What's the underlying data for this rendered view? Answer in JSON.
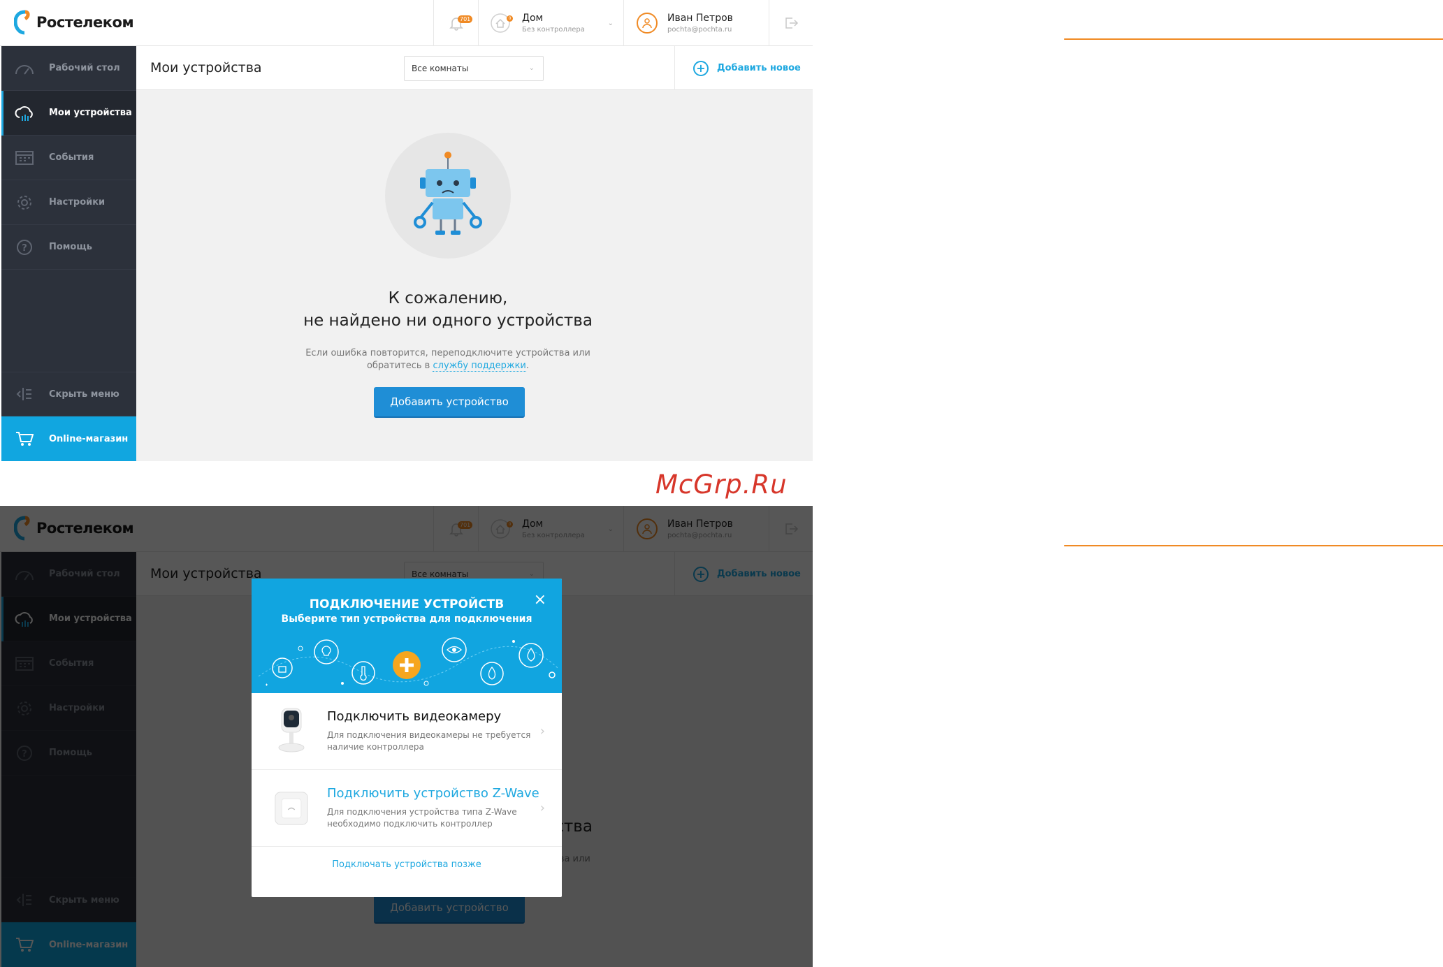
{
  "brand": {
    "name": "Ростелеком"
  },
  "header": {
    "notifications_badge": "701",
    "home_badge": "0",
    "home_name": "Дом",
    "home_sub": "Без контроллера",
    "user_name": "Иван Петров",
    "user_email": "pochta@pochta.ru"
  },
  "sidebar": {
    "items": [
      {
        "label": "Рабочий стол",
        "icon": "dashboard-icon"
      },
      {
        "label": "Мои устройства",
        "icon": "cloud-devices-icon"
      },
      {
        "label": "События",
        "icon": "calendar-icon"
      },
      {
        "label": "Настройки",
        "icon": "gear-icon"
      },
      {
        "label": "Помощь",
        "icon": "help-icon"
      }
    ],
    "hide_menu": "Скрыть меню",
    "shop": "Online-магазин"
  },
  "main": {
    "title": "Мои устройства",
    "room_select": "Все комнаты",
    "add_new": "Добавить новое",
    "empty_line1": "К сожалению,",
    "empty_line2": "не найдено ни одного устройства",
    "help_text1": "Если ошибка повторится, переподключите устройства или",
    "help_text2_prefix": "обратитесь в",
    "help_link": "службу поддержки",
    "help_text2_suffix": ".",
    "add_device_button": "Добавить устройство"
  },
  "modal": {
    "title": "ПОДКЛЮЧЕНИЕ УСТРОЙСТВ",
    "subtitle": "Выберите тип устройства для подключения",
    "options": [
      {
        "title": "Подключить видеокамеру",
        "desc1": "Для подключения видеокамеры не требуется",
        "desc2": "наличие контроллера"
      },
      {
        "title": "Подключить устройство Z-Wave",
        "desc1": "Для подключения устройства типа Z-Wave",
        "desc2": "необходимо подключить контроллер"
      }
    ],
    "later": "Подключать устройства позже"
  },
  "watermark": "McGrp.Ru",
  "colors": {
    "accent": "#11a5e0",
    "brand_orange": "#f08a24",
    "sidebar": "#2c313b",
    "button": "#1f8ed6"
  }
}
